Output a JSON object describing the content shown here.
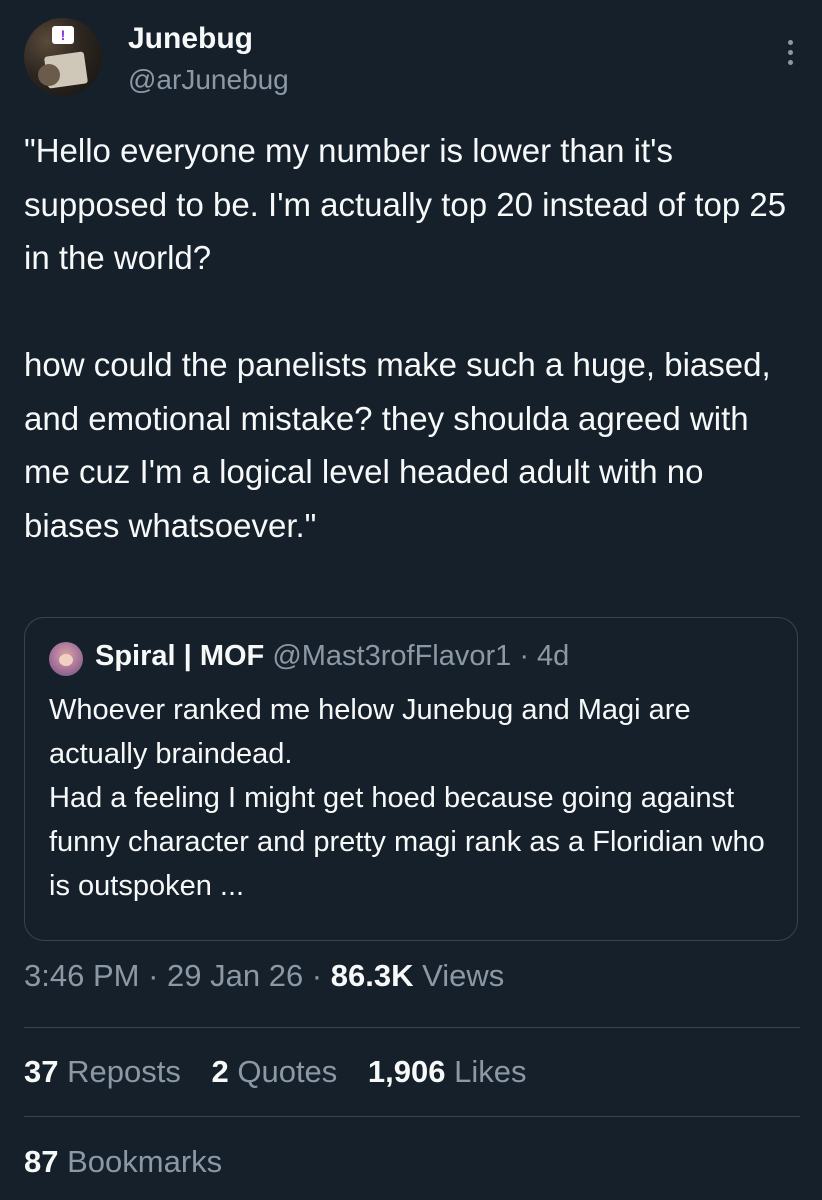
{
  "author": {
    "name": "Junebug",
    "handle": "@arJunebug"
  },
  "tweet": {
    "text": "\"Hello everyone my number is lower than it's supposed to be. I'm actually top 20 instead of top 25 in the world?\n\nhow could the panelists make such a huge, biased, and emotional mistake? they shoulda agreed with me cuz I'm a logical level headed adult with no biases whatsoever.\""
  },
  "quote": {
    "name": "Spiral | MOF",
    "handle": "@Mast3rofFlavor1",
    "separator": " · ",
    "time": "4d",
    "text": "Whoever ranked me helow Junebug and Magi are actually braindead.\nHad a feeling I might get hoed because going against funny character and pretty magi rank as a Floridian who is outspoken ..."
  },
  "meta": {
    "time": "3:46 PM",
    "separator": " · ",
    "date": "29 Jan 26",
    "views_count": "86.3K",
    "views_label": "Views"
  },
  "stats": {
    "reposts_count": "37",
    "reposts_label": "Reposts",
    "quotes_count": "2",
    "quotes_label": "Quotes",
    "likes_count": "1,906",
    "likes_label": "Likes"
  },
  "bookmarks": {
    "count": "87",
    "label": "Bookmarks"
  },
  "colors": {
    "background": "#15202b",
    "text": "#f7f9f9",
    "muted": "#8b98a5",
    "border": "#38444d"
  }
}
